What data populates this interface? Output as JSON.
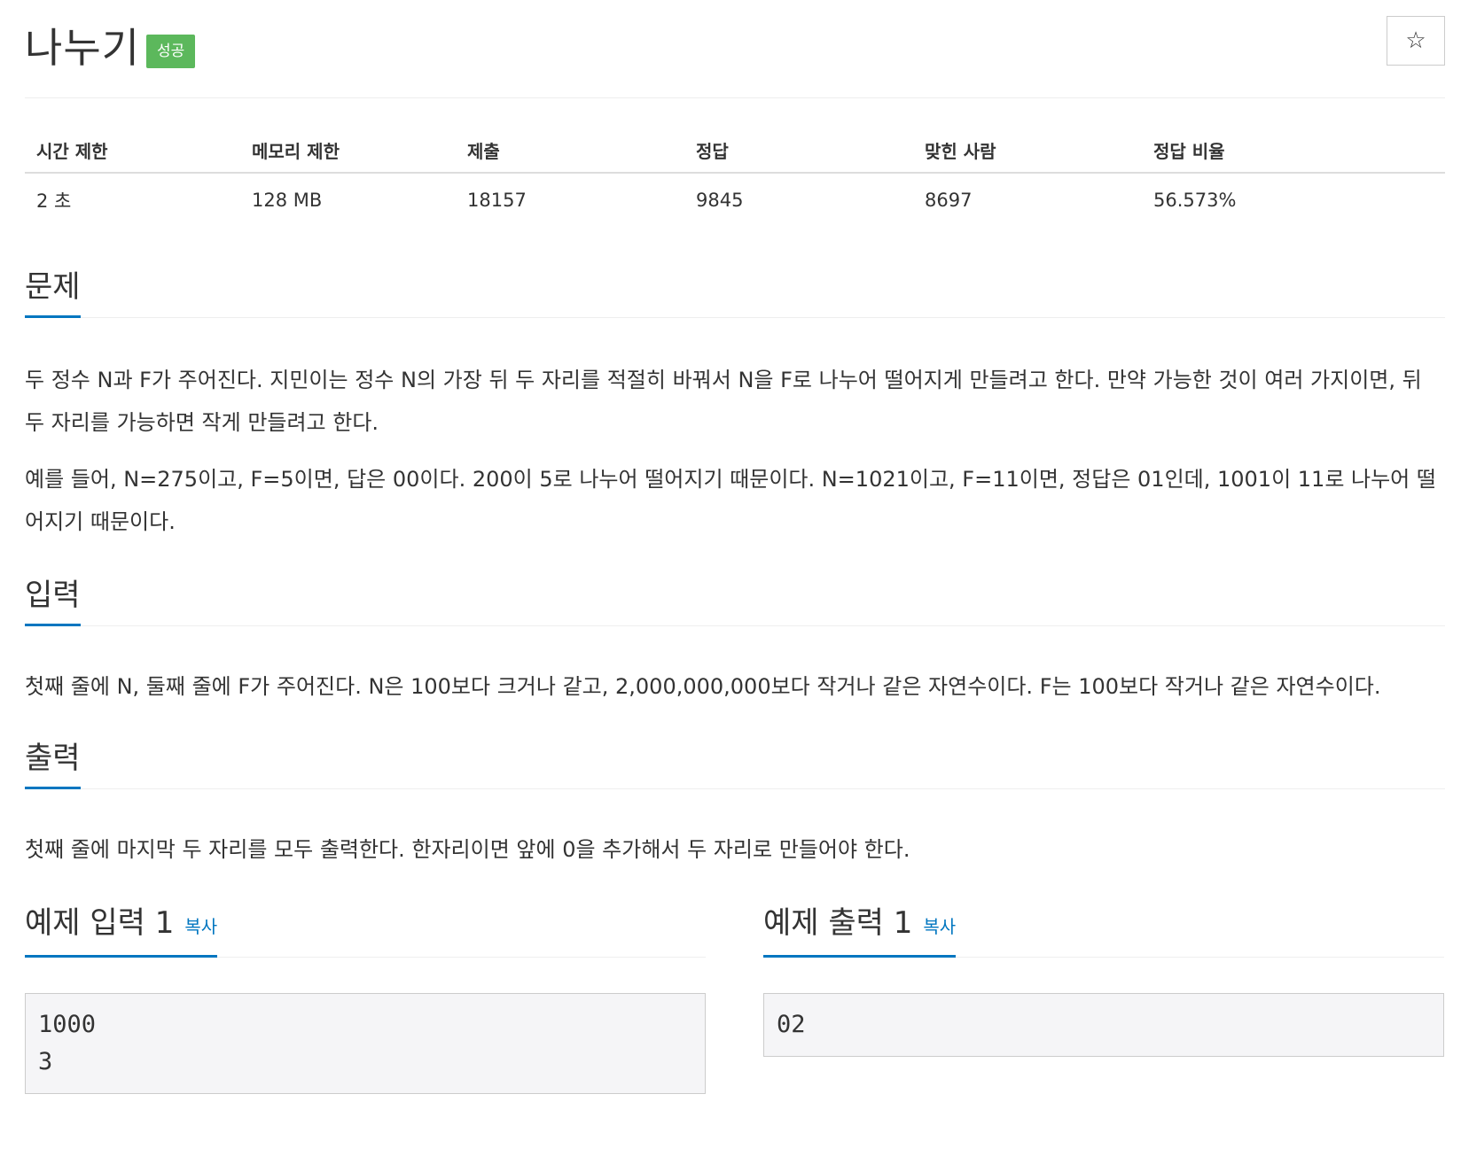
{
  "problem": {
    "title": "나누기",
    "status_badge": "성공",
    "star_icon": "☆"
  },
  "info_table": {
    "headers": [
      "시간 제한",
      "메모리 제한",
      "제출",
      "정답",
      "맞힌 사람",
      "정답 비율"
    ],
    "values": [
      "2 초",
      "128 MB",
      "18157",
      "9845",
      "8697",
      "56.573%"
    ]
  },
  "sections": {
    "description": {
      "title": "문제",
      "paragraphs": [
        "두 정수 N과 F가 주어진다. 지민이는 정수 N의 가장 뒤 두 자리를 적절히 바꿔서 N을 F로 나누어 떨어지게 만들려고 한다. 만약 가능한 것이 여러 가지이면, 뒤 두 자리를 가능하면 작게 만들려고 한다.",
        "예를 들어, N=275이고, F=5이면, 답은 00이다. 200이 5로 나누어 떨어지기 때문이다. N=1021이고, F=11이면, 정답은 01인데, 1001이 11로 나누어 떨어지기 때문이다."
      ]
    },
    "input": {
      "title": "입력",
      "text": "첫째 줄에 N, 둘째 줄에 F가 주어진다. N은 100보다 크거나 같고, 2,000,000,000보다 작거나 같은 자연수이다. F는 100보다 작거나 같은 자연수이다."
    },
    "output": {
      "title": "출력",
      "text": "첫째 줄에 마지막 두 자리를 모두 출력한다. 한자리이면 앞에 0을 추가해서 두 자리로 만들어야 한다."
    }
  },
  "samples": {
    "input": {
      "title": "예제 입력 1",
      "copy_label": "복사",
      "content": "1000\n3"
    },
    "output": {
      "title": "예제 출력 1",
      "copy_label": "복사",
      "content": "02"
    }
  },
  "colors": {
    "badge_success": "#5cb85c",
    "accent_blue": "#0076c0",
    "sample_bg": "#f5f5f7"
  }
}
